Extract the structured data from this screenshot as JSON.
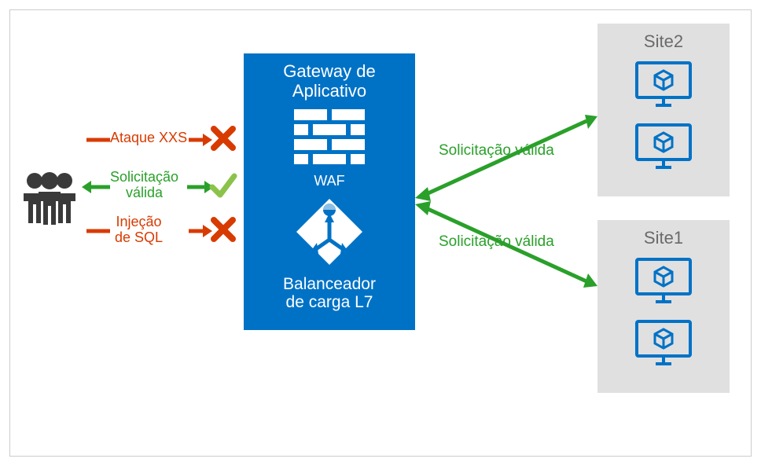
{
  "diagram": {
    "gateway": {
      "title_line1": "Gateway de",
      "title_line2": "Aplicativo",
      "waf_label": "WAF",
      "lb_label_line1": "Balanceador",
      "lb_label_line2": "de carga L7"
    },
    "attacks": {
      "xss": "Ataque XXS",
      "sql_line1": "Injeção",
      "sql_line2": "de SQL"
    },
    "valid": {
      "line1": "Solicitação",
      "line2": "válida",
      "right_label": "Solicitação válida"
    },
    "sites": {
      "site1": "Site1",
      "site2": "Site2"
    },
    "colors": {
      "azure": "#0072c6",
      "red": "#d83b01",
      "green": "#2aa02a",
      "gray": "#6a6a6a",
      "sitebg": "#e0e0e0"
    }
  }
}
